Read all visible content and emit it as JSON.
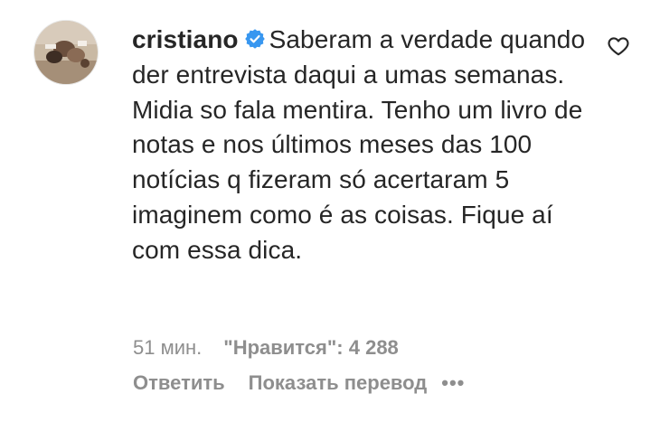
{
  "comment": {
    "username": "cristiano",
    "verified": true,
    "text": "Saberam a verdade quando der entrevista daqui a umas semanas. Midia so fala mentira. Tenho um livro de notas e nos últimos meses das 100 notícias q fizeram só acertaram 5 imaginem como é as coisas. Fique aí com essa dica.",
    "time": "51 мин.",
    "likes": "\"Нравится\": 4 288",
    "reply_label": "Ответить",
    "translate_label": "Показать перевод",
    "more_label": "•••"
  },
  "icons": {
    "verified": "verified-badge-icon",
    "like": "heart-icon",
    "more": "more-options-icon"
  },
  "colors": {
    "text": "#262626",
    "secondary": "#8e8e8e",
    "verified_blue": "#3897f0",
    "background": "#ffffff"
  }
}
